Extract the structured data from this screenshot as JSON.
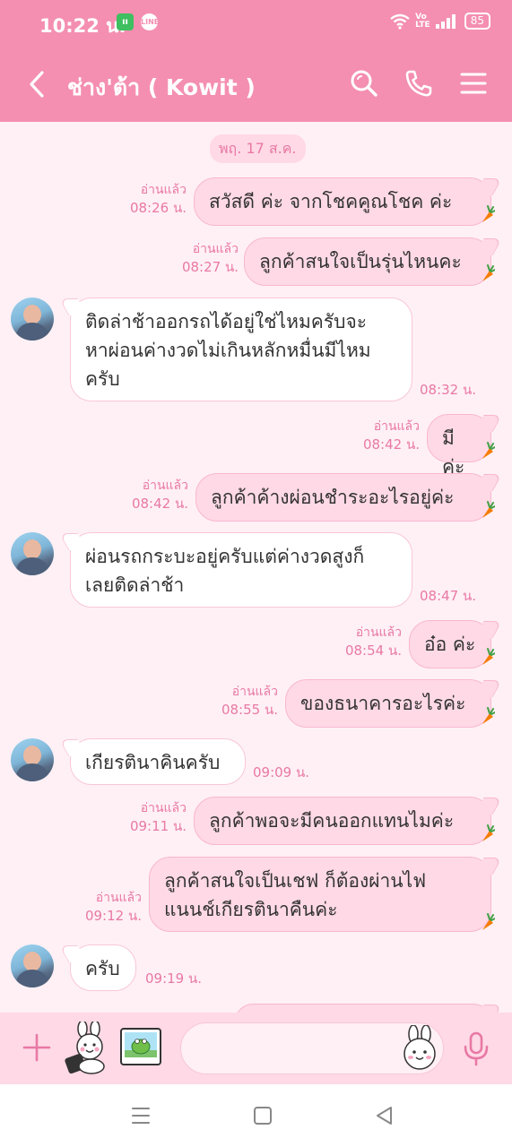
{
  "status_bar": {
    "time": "10:22 น.",
    "notif_app": "ıı",
    "notif_line": "LINE",
    "volte_top": "Vo",
    "volte_bottom": "LTE",
    "battery": "85"
  },
  "header": {
    "title": "ช่าง'ต้า ( Kowit )",
    "bg_color": "#f48fb1"
  },
  "chat": {
    "date": "พฤ. 17 ส.ค.",
    "messages": [
      {
        "dir": "out",
        "text": "สวัสดี ค่ะ จากโชคคูณโชค  ค่ะ",
        "read": "อ่านแล้ว",
        "time": "08:26 น."
      },
      {
        "dir": "out",
        "text": "ลูกค้าสนใจเป็นรุ่นไหนคะ",
        "read": "อ่านแล้ว",
        "time": "08:27 น."
      },
      {
        "dir": "in",
        "line1": "ติดล่าช้าออกรถได้อยู่ใช่ไหมครับจะ",
        "line2": "หาผ่อนค่างวดไม่เกินหลักหมื่นมีไหม",
        "line3": "ครับ",
        "time": "08:32 น."
      },
      {
        "dir": "out",
        "text": "มีค่ะ",
        "read": "อ่านแล้ว",
        "time": "08:42 น."
      },
      {
        "dir": "out",
        "text": "ลูกค้าค้างผ่อนชำระอะไรอยู่ค่ะ",
        "read": "อ่านแล้ว",
        "time": "08:42 น."
      },
      {
        "dir": "in",
        "line1": "ผ่อนรถกระบะอยู่ครับแต่ค่างวดสูงก็",
        "line2": "เลยติดล่าช้า",
        "time": "08:47 น."
      },
      {
        "dir": "out",
        "text": "อ๋อ ค่ะ",
        "read": "อ่านแล้ว",
        "time": "08:54 น."
      },
      {
        "dir": "out",
        "text": "ของธนาคารอะไรค่ะ",
        "read": "อ่านแล้ว",
        "time": "08:55 น."
      },
      {
        "dir": "in",
        "text": "เกียรตินาคินครับ",
        "time": "09:09 น."
      },
      {
        "dir": "out",
        "text": "ลูกค้าพอจะมีคนออกแทนไมค่ะ",
        "read": "อ่านแล้ว",
        "time": "09:11 น."
      },
      {
        "dir": "out",
        "line1": "ลูกค้าสนใจเป็นเชฟ ก็ต้องผ่านไฟ",
        "line2": "แนนช์เกียรตินาคืนค่ะ",
        "read": "อ่านแล้ว",
        "time": "09:12 น."
      },
      {
        "dir": "in",
        "text": "ครับ",
        "time": "09:19 น."
      }
    ]
  },
  "input": {
    "placeholder": ""
  },
  "colors": {
    "accent": "#f48fb1",
    "bubble_out": "#ffd9e6",
    "background": "#fff0f5"
  }
}
